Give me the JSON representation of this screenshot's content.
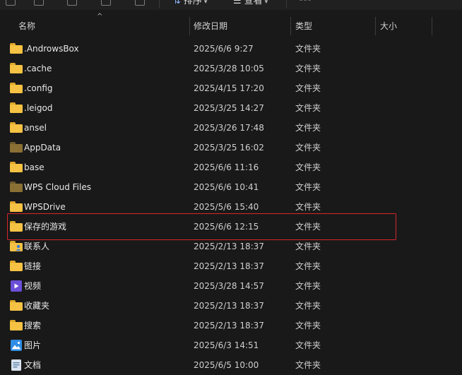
{
  "toolbar": {
    "sort_label": "排序",
    "view_label": "查看",
    "more_label": "⋯"
  },
  "columns": {
    "name": "名称",
    "modified": "修改日期",
    "type": "类型",
    "size": "大小"
  },
  "files": [
    {
      "name": ".AndrowsBox",
      "date": "2025/6/6 9:27",
      "type": "文件夹",
      "icon": "folder-icon"
    },
    {
      "name": ".cache",
      "date": "2025/3/28 10:05",
      "type": "文件夹",
      "icon": "folder-icon"
    },
    {
      "name": ".config",
      "date": "2025/4/15 17:20",
      "type": "文件夹",
      "icon": "folder-icon"
    },
    {
      "name": ".leigod",
      "date": "2025/3/25 14:27",
      "type": "文件夹",
      "icon": "folder-icon"
    },
    {
      "name": "ansel",
      "date": "2025/3/26 17:48",
      "type": "文件夹",
      "icon": "folder-icon"
    },
    {
      "name": "AppData",
      "date": "2025/3/25 16:02",
      "type": "文件夹",
      "icon": "dim-folder-icon"
    },
    {
      "name": "base",
      "date": "2025/6/6 11:16",
      "type": "文件夹",
      "icon": "folder-icon"
    },
    {
      "name": "WPS Cloud Files",
      "date": "2025/6/6 10:41",
      "type": "文件夹",
      "icon": "dim-folder-icon"
    },
    {
      "name": "WPSDrive",
      "date": "2025/5/6 15:40",
      "type": "文件夹",
      "icon": "folder-icon"
    },
    {
      "name": "保存的游戏",
      "date": "2025/6/6 12:15",
      "type": "文件夹",
      "icon": "folder-icon"
    },
    {
      "name": "联系人",
      "date": "2025/2/13 18:37",
      "type": "文件夹",
      "icon": "contacts-folder-icon"
    },
    {
      "name": "链接",
      "date": "2025/2/13 18:37",
      "type": "文件夹",
      "icon": "folder-icon"
    },
    {
      "name": "视频",
      "date": "2025/3/28 14:57",
      "type": "文件夹",
      "icon": "videos-folder-icon"
    },
    {
      "name": "收藏夹",
      "date": "2025/2/13 18:37",
      "type": "文件夹",
      "icon": "folder-icon"
    },
    {
      "name": "搜索",
      "date": "2025/2/13 18:37",
      "type": "文件夹",
      "icon": "folder-icon"
    },
    {
      "name": "图片",
      "date": "2025/6/3 14:51",
      "type": "文件夹",
      "icon": "pictures-folder-icon"
    },
    {
      "name": "文档",
      "date": "2025/6/5 10:00",
      "type": "文件夹",
      "icon": "documents-folder-icon"
    }
  ],
  "colors": {
    "background": "#191919",
    "folder_yellow": "#f6c244",
    "folder_dim": "#8a7034",
    "highlight_border": "#d7262b",
    "video_icon": "#6b4fd8",
    "picture_icon": "#2f8de4"
  }
}
